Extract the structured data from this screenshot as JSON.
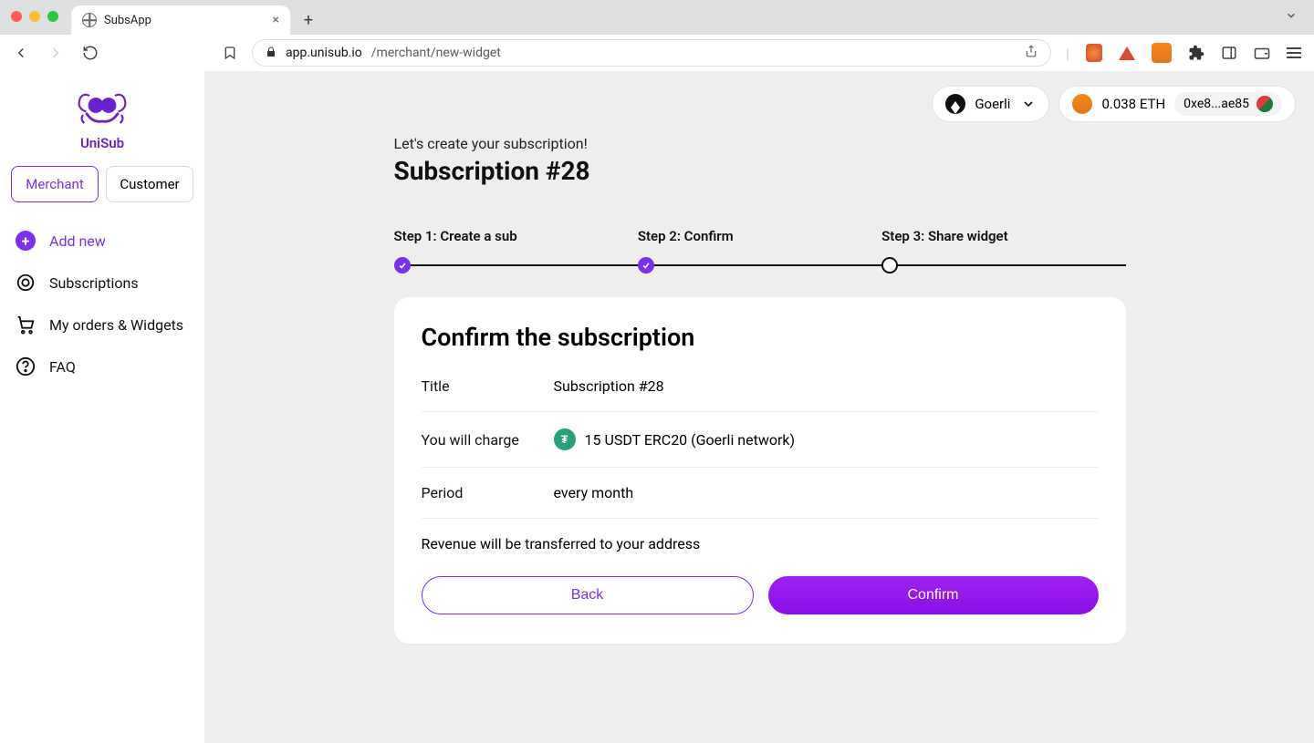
{
  "chrome": {
    "tab_title": "SubsApp",
    "url_host": "app.unisub.io",
    "url_path": "/merchant/new-widget"
  },
  "sidebar": {
    "brand": "UniSub",
    "roles": {
      "merchant": "Merchant",
      "customer": "Customer"
    },
    "nav": {
      "add_new": "Add new",
      "subscriptions": "Subscriptions",
      "orders": "My orders & Widgets",
      "faq": "FAQ"
    }
  },
  "header": {
    "network": "Goerli",
    "balance": "0.038 ETH",
    "address": "0xe8...ae85"
  },
  "page": {
    "eyebrow": "Let's create your subscription!",
    "title": "Subscription #28",
    "steps": {
      "s1": "Step 1: Create a sub",
      "s2": "Step 2: Confirm",
      "s3": "Step 3: Share widget"
    },
    "card": {
      "heading": "Confirm the subscription",
      "labels": {
        "title": "Title",
        "charge": "You will charge",
        "period": "Period"
      },
      "values": {
        "title": "Subscription #28",
        "charge": "15 USDT ERC20 (Goerli network)",
        "period": "every month"
      },
      "revenue_note": "Revenue will be transferred to your address",
      "buttons": {
        "back": "Back",
        "confirm": "Confirm"
      }
    }
  }
}
